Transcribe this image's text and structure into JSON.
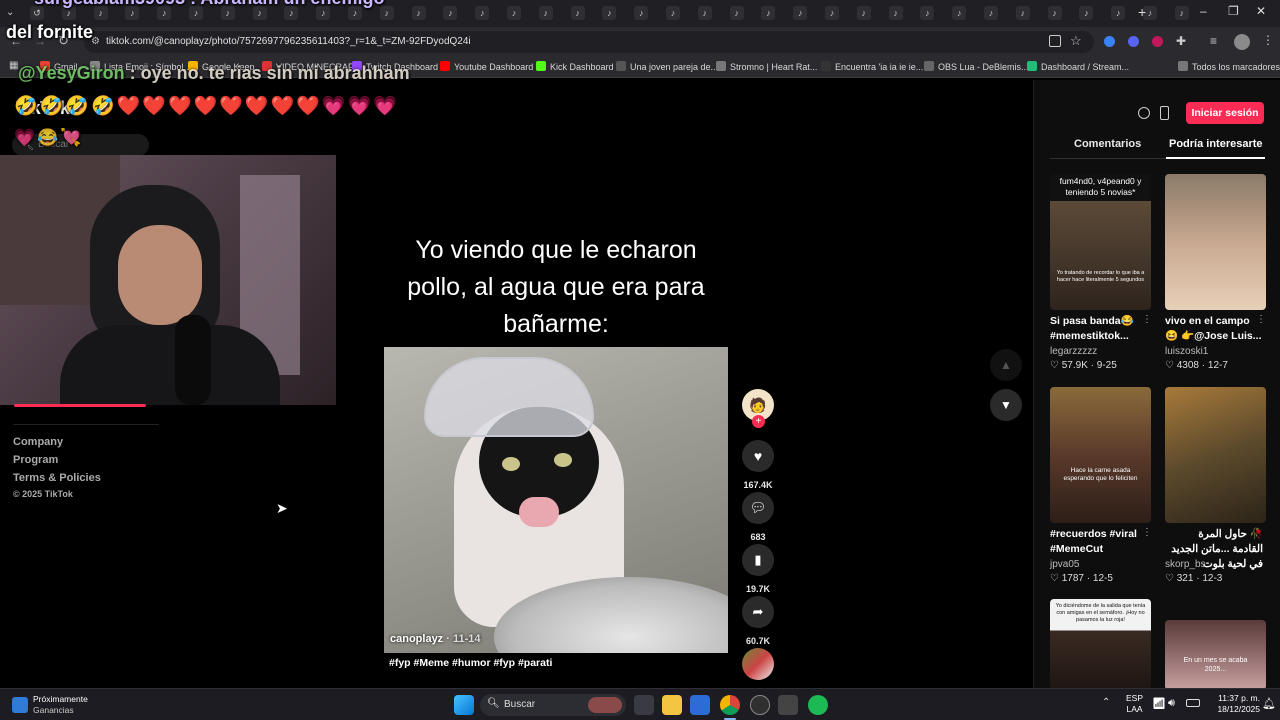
{
  "browser": {
    "tab_glyphs": [
      "↺",
      "♪",
      "♪",
      "♪",
      "♪",
      "♪",
      "♪",
      "♪",
      "♪",
      "♪",
      "♪",
      "♪",
      "♪",
      "♪",
      "♪",
      "♪",
      "♪",
      "♪",
      "♪",
      "♪",
      "♪",
      "♪",
      "♪",
      "♪",
      "♪",
      "♪",
      "♪",
      "♪",
      "♪",
      "♪",
      "♪",
      "♪",
      "♪",
      "♪",
      "♪",
      "♪",
      "♪"
    ],
    "new_tab_label": "+",
    "address": "tiktok.com/@canoplayz/photo/7572697796235611403?_r=1&_t=ZM-92FDyodQ24i",
    "bookmarks": [
      "Gmail",
      "Lista Emoji : Símbol...",
      "Google Keep",
      "VIDEO MINECRAFT",
      "Twitch Dashboard",
      "Youtube Dashboard",
      "Kick Dashboard",
      "Una joven pareja de...",
      "Stromno | Heart Rat...",
      "Encuentra 'ia ia ie ie...",
      "OBS Lua - DeBlemis...",
      "Dashboard / Stream..."
    ],
    "all_bookmarks_label": "Todos los marcadores"
  },
  "stream_overlay": {
    "top_line": "surgeabiam39093 : Abraham un enemigo",
    "second_line": "del fornite",
    "chat_user": "@YesyGiron",
    "chat_text": " : oye no. te rias sin mi abrahham",
    "emoji_row": "🤣🤣🤣🤣❤️❤️❤️❤️❤️❤️❤️❤️💗💗💗",
    "emoji_row2": "💗😂💘",
    "search_placeholder": "Buscar",
    "tiktok_word": "TikTok"
  },
  "left_footer": {
    "links": [
      "Company",
      "Program",
      "Terms & Policies"
    ],
    "copyright": "© 2025 TikTok"
  },
  "post": {
    "caption_lines": [
      "Yo viendo que le echaron",
      "pollo, al agua que era para",
      "bañarme:"
    ],
    "author": "canoplayz",
    "date": "11-14",
    "hashtags": "#fyp #Meme #humor #fyp #parati"
  },
  "actions": {
    "likes": "167.4K",
    "comments": "683",
    "saves": "19.7K",
    "shares": "60.7K"
  },
  "right_panel": {
    "login_button": "Iniciar sesión",
    "tabs": [
      "Comentarios",
      "Podría interesarte"
    ],
    "active_tab": 1,
    "suggestions": [
      {
        "overlay": "fum4nd0, v4peand0 y teniendo 5 novias*",
        "inner": "Yo tratando de recordar lo que iba a hacer hace literalmente 5 segundos",
        "title": "Si pasa banda😂 #memestiktok...",
        "user": "legarzzzzz",
        "likes": "57.9K",
        "date": "9-25"
      },
      {
        "overlay": "",
        "inner": "",
        "title": "vivo en el campo 😆 👉@Jose Luis...",
        "user": "luiszoski1",
        "likes": "4308",
        "date": "12-7"
      },
      {
        "overlay": "",
        "inner": "Hace la carne asada esperando que lo feliciten",
        "title": "#recuerdos #viral #MemeCut",
        "user": "jpva05",
        "likes": "1787",
        "date": "12-5"
      },
      {
        "overlay": "",
        "inner": "",
        "title": "🥀 حاول المرة القادمة ...ماتن الجديد في لحية بلوت",
        "user": "skorp_bs",
        "likes": "321",
        "date": "12-3"
      },
      {
        "overlay": "",
        "inner": "Yo diciéndome de la salida que tenía con amigas en el semáforo. ¡Hoy no pasamos la luz roja!",
        "title": "",
        "user": "",
        "likes": "",
        "date": ""
      },
      {
        "overlay": "",
        "inner": "En un mes se acaba 2025...",
        "title": "",
        "user": "",
        "likes": "",
        "date": ""
      }
    ]
  },
  "taskbar": {
    "weather_title": "Próximamente",
    "weather_sub": "Ganancias",
    "search": "Buscar",
    "lang": "ESP",
    "lang_sub": "LAA",
    "time": "11:37 p. m.",
    "date": "18/12/2025"
  },
  "colors": {
    "accent": "#fe2c55",
    "bg": "#000000"
  }
}
